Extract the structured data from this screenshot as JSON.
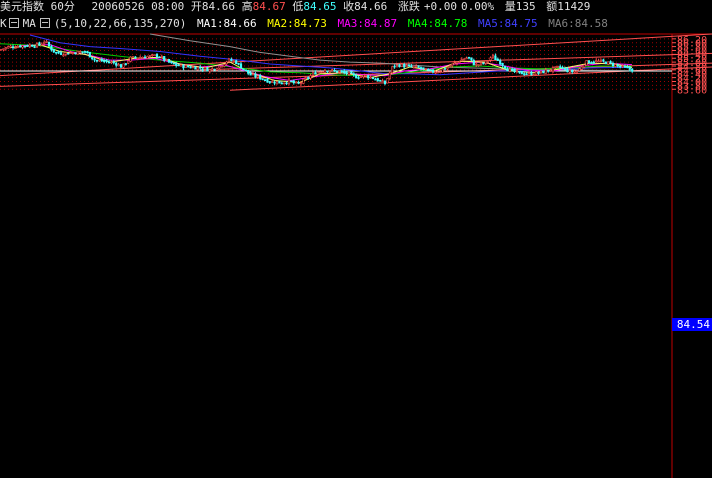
{
  "header": {
    "title": "美元指数 60分",
    "date_time": "20060526 08:00",
    "open_label": "开",
    "open": "84.66",
    "high_label": "高",
    "high": "84.67",
    "low_label": "低",
    "low": "84.65",
    "close_label": "收",
    "close": "84.66",
    "change_label": "涨跌",
    "change": "+0.00",
    "change_pct": "0.00%",
    "volume_label": "量",
    "volume": "135",
    "amount_label": "额",
    "amount": "11429"
  },
  "ma_row": {
    "k_label": "K",
    "ma_label": "MA",
    "params": "(5,10,22,66,135,270)",
    "items": [
      {
        "label": "MA1:",
        "value": "84.66",
        "color": "#ffffff"
      },
      {
        "label": "MA2:",
        "value": "84.73",
        "color": "#ffff00"
      },
      {
        "label": "MA3:",
        "value": "84.87",
        "color": "#ff00ff"
      },
      {
        "label": "MA4:",
        "value": "84.78",
        "color": "#00ff00"
      },
      {
        "label": "MA5:",
        "value": "84.75",
        "color": "#4040ff"
      },
      {
        "label": "MA6:",
        "value": "84.58",
        "color": "#808080"
      }
    ]
  },
  "last_price_tag": "84.54",
  "colors": {
    "up": "#ff5050",
    "down": "#40ffff",
    "grid": "#a00000",
    "axis_text": "#ff5050",
    "channel": "#ff5050"
  },
  "chart_data": {
    "type": "candlestick",
    "ylim": [
      63.55,
      86.45
    ],
    "y_ticks": [
      "86.20",
      "86.00",
      "85.80",
      "85.60",
      "85.40",
      "85.20",
      "85.00",
      "84.80",
      "84.60",
      "84.40",
      "84.20",
      "84.00",
      "83.80",
      "83.60"
    ],
    "close_path": [
      [
        0,
        85.65
      ],
      [
        10,
        85.8
      ],
      [
        25,
        85.85
      ],
      [
        40,
        85.9
      ],
      [
        45,
        86.1
      ],
      [
        50,
        85.75
      ],
      [
        55,
        85.5
      ],
      [
        62,
        85.45
      ],
      [
        75,
        85.5
      ],
      [
        85,
        85.55
      ],
      [
        95,
        85.1
      ],
      [
        105,
        85.05
      ],
      [
        115,
        84.95
      ],
      [
        122,
        84.75
      ],
      [
        130,
        85.2
      ],
      [
        140,
        85.25
      ],
      [
        150,
        85.3
      ],
      [
        158,
        85.35
      ],
      [
        165,
        85.1
      ],
      [
        172,
        84.9
      ],
      [
        180,
        84.8
      ],
      [
        190,
        84.75
      ],
      [
        200,
        84.7
      ],
      [
        210,
        84.6
      ],
      [
        220,
        84.8
      ],
      [
        228,
        85.1
      ],
      [
        235,
        85.05
      ],
      [
        242,
        84.7
      ],
      [
        250,
        84.35
      ],
      [
        260,
        84.2
      ],
      [
        270,
        84.0
      ],
      [
        280,
        83.95
      ],
      [
        290,
        84.0
      ],
      [
        298,
        83.85
      ],
      [
        305,
        84.1
      ],
      [
        315,
        84.45
      ],
      [
        325,
        84.6
      ],
      [
        332,
        84.55
      ],
      [
        340,
        84.5
      ],
      [
        348,
        84.4
      ],
      [
        356,
        84.25
      ],
      [
        365,
        84.3
      ],
      [
        375,
        84.15
      ],
      [
        385,
        83.9
      ],
      [
        393,
        84.8
      ],
      [
        400,
        84.85
      ],
      [
        410,
        84.75
      ],
      [
        420,
        84.7
      ],
      [
        430,
        84.5
      ],
      [
        440,
        84.55
      ],
      [
        450,
        84.8
      ],
      [
        460,
        85.1
      ],
      [
        468,
        85.25
      ],
      [
        475,
        84.85
      ],
      [
        485,
        84.95
      ],
      [
        492,
        85.3
      ],
      [
        500,
        85.0
      ],
      [
        508,
        84.6
      ],
      [
        518,
        84.45
      ],
      [
        530,
        84.4
      ],
      [
        540,
        84.45
      ],
      [
        550,
        84.6
      ],
      [
        560,
        84.75
      ],
      [
        570,
        84.5
      ],
      [
        578,
        84.55
      ],
      [
        585,
        85.0
      ],
      [
        595,
        85.05
      ],
      [
        605,
        85.0
      ],
      [
        615,
        84.85
      ],
      [
        625,
        84.7
      ],
      [
        632,
        84.6
      ]
    ],
    "ma_lines": [
      {
        "name": "MA5",
        "color": "#3333ff",
        "points": [
          [
            30,
            86.4
          ],
          [
            60,
            86.0
          ],
          [
            90,
            85.8
          ],
          [
            120,
            85.7
          ],
          [
            160,
            85.55
          ],
          [
            200,
            85.3
          ],
          [
            240,
            85.1
          ],
          [
            270,
            84.9
          ],
          [
            300,
            84.8
          ],
          [
            330,
            84.7
          ],
          [
            360,
            84.55
          ],
          [
            385,
            84.4
          ],
          [
            410,
            84.4
          ],
          [
            440,
            84.35
          ],
          [
            470,
            84.45
          ],
          [
            500,
            84.55
          ],
          [
            530,
            84.55
          ],
          [
            560,
            84.6
          ],
          [
            590,
            84.7
          ],
          [
            615,
            84.72
          ],
          [
            632,
            84.72
          ]
        ]
      },
      {
        "name": "MA6",
        "color": "#909090",
        "points": [
          [
            150,
            86.45
          ],
          [
            190,
            86.1
          ],
          [
            230,
            85.8
          ],
          [
            260,
            85.5
          ],
          [
            290,
            85.3
          ],
          [
            320,
            85.1
          ],
          [
            350,
            85.0
          ],
          [
            380,
            84.95
          ],
          [
            410,
            84.85
          ],
          [
            440,
            84.75
          ],
          [
            470,
            84.7
          ],
          [
            500,
            84.65
          ],
          [
            530,
            84.62
          ],
          [
            560,
            84.6
          ],
          [
            590,
            84.58
          ],
          [
            632,
            84.57
          ]
        ]
      },
      {
        "name": "MA4",
        "color": "#00cc00",
        "points": [
          [
            0,
            85.95
          ],
          [
            40,
            85.85
          ],
          [
            80,
            85.55
          ],
          [
            120,
            85.3
          ],
          [
            160,
            85.1
          ],
          [
            200,
            84.95
          ],
          [
            240,
            84.7
          ],
          [
            270,
            84.5
          ],
          [
            300,
            84.45
          ],
          [
            330,
            84.35
          ],
          [
            360,
            84.3
          ],
          [
            390,
            84.35
          ],
          [
            420,
            84.55
          ],
          [
            450,
            84.75
          ],
          [
            480,
            84.8
          ],
          [
            510,
            84.7
          ],
          [
            540,
            84.65
          ],
          [
            570,
            84.7
          ],
          [
            600,
            84.8
          ],
          [
            632,
            84.78
          ]
        ]
      },
      {
        "name": "MA3",
        "color": "#ff00ff",
        "points": [
          [
            20,
            85.85
          ],
          [
            50,
            85.9
          ],
          [
            70,
            85.55
          ],
          [
            90,
            85.35
          ],
          [
            110,
            85.1
          ],
          [
            130,
            85.1
          ],
          [
            155,
            85.2
          ],
          [
            175,
            84.95
          ],
          [
            200,
            84.75
          ],
          [
            225,
            84.85
          ],
          [
            245,
            84.55
          ],
          [
            265,
            84.25
          ],
          [
            290,
            84.05
          ],
          [
            315,
            84.25
          ],
          [
            340,
            84.45
          ],
          [
            365,
            84.35
          ],
          [
            385,
            84.3
          ],
          [
            405,
            84.55
          ],
          [
            430,
            84.65
          ],
          [
            455,
            84.9
          ],
          [
            480,
            85.0
          ],
          [
            505,
            84.8
          ],
          [
            530,
            84.55
          ],
          [
            555,
            84.55
          ],
          [
            580,
            84.8
          ],
          [
            605,
            84.95
          ],
          [
            632,
            84.87
          ]
        ]
      },
      {
        "name": "MA2",
        "color": "#ffff66",
        "points": [
          [
            10,
            85.75
          ],
          [
            40,
            85.9
          ],
          [
            60,
            85.55
          ],
          [
            85,
            85.4
          ],
          [
            110,
            85.0
          ],
          [
            135,
            85.2
          ],
          [
            160,
            85.25
          ],
          [
            180,
            84.9
          ],
          [
            205,
            84.7
          ],
          [
            230,
            85.0
          ],
          [
            250,
            84.45
          ],
          [
            275,
            84.05
          ],
          [
            300,
            83.95
          ],
          [
            320,
            84.4
          ],
          [
            345,
            84.45
          ],
          [
            370,
            84.2
          ],
          [
            390,
            84.4
          ],
          [
            410,
            84.75
          ],
          [
            435,
            84.55
          ],
          [
            460,
            85.05
          ],
          [
            485,
            85.0
          ],
          [
            510,
            84.55
          ],
          [
            535,
            84.45
          ],
          [
            560,
            84.65
          ],
          [
            590,
            84.95
          ],
          [
            615,
            84.9
          ],
          [
            632,
            84.73
          ]
        ]
      }
    ],
    "channel_lines": [
      {
        "from": [
          0,
          84.3
        ],
        "to": [
          712,
          86.45
        ]
      },
      {
        "from": [
          200,
          84.6
        ],
        "to": [
          712,
          85.45
        ]
      },
      {
        "from": [
          0,
          83.75
        ],
        "to": [
          712,
          84.95
        ]
      },
      {
        "from": [
          230,
          83.55
        ],
        "to": [
          712,
          84.75
        ]
      }
    ],
    "last_price": 84.54
  }
}
